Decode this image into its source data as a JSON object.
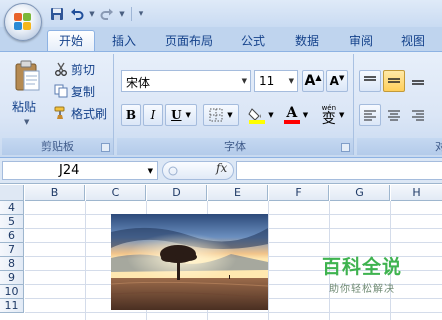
{
  "quick_access": {
    "save": "save-icon",
    "undo": "undo-icon",
    "redo": "redo-icon"
  },
  "tabs": [
    {
      "label": "开始",
      "active": true
    },
    {
      "label": "插入"
    },
    {
      "label": "页面布局"
    },
    {
      "label": "公式"
    },
    {
      "label": "数据"
    },
    {
      "label": "审阅"
    },
    {
      "label": "视图"
    }
  ],
  "clipboard": {
    "paste_label": "粘贴",
    "cut_label": "剪切",
    "copy_label": "复制",
    "format_painter_label": "格式刷",
    "group_label": "剪贴板"
  },
  "font": {
    "font_name": "宋体",
    "font_size": "11",
    "grow_label": "A",
    "shrink_label": "A",
    "bold_label": "B",
    "italic_label": "I",
    "underline_label": "U",
    "font_color_label": "A",
    "phonetic_label": "变",
    "phonetic_small": "wén",
    "group_label": "字体",
    "fill_color": "#ffff00",
    "font_color": "#ff0000"
  },
  "alignment": {
    "group_label": "对"
  },
  "formula_bar": {
    "cell_ref": "J24",
    "fx_label": "fx",
    "content": ""
  },
  "columns": [
    "B",
    "C",
    "D",
    "E",
    "F",
    "G",
    "H"
  ],
  "rows": [
    "4",
    "5",
    "6",
    "7",
    "8",
    "9",
    "10",
    "11"
  ],
  "watermark": {
    "title": "百科全说",
    "subtitle": "助你轻松解决"
  }
}
